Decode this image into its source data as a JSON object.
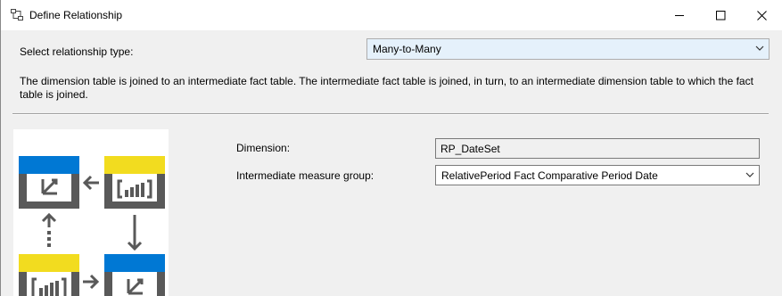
{
  "window": {
    "title": "Define Relationship"
  },
  "relationship": {
    "label": "Select relationship type:",
    "selected": "Many-to-Many",
    "description": "The dimension table is joined to an intermediate fact table. The intermediate fact table is joined, in turn, to an intermediate dimension table to which the fact table is joined."
  },
  "fields": {
    "dimension_label": "Dimension:",
    "dimension_value": "RP_DateSet",
    "measure_group_label": "Intermediate measure group:",
    "measure_group_value": "RelativePeriod Fact Comparative Period Date"
  },
  "icons": {
    "titlebar": "relationship-icon",
    "minimize": "minimize-icon",
    "maximize": "maximize-icon",
    "close": "close-icon",
    "dropdown": "chevron-down-icon"
  },
  "colors": {
    "dimension_header": "#0078d4",
    "fact_header": "#f2dc1f",
    "table_body": "#595959",
    "selected_combo_bg": "#e5f1fb"
  }
}
